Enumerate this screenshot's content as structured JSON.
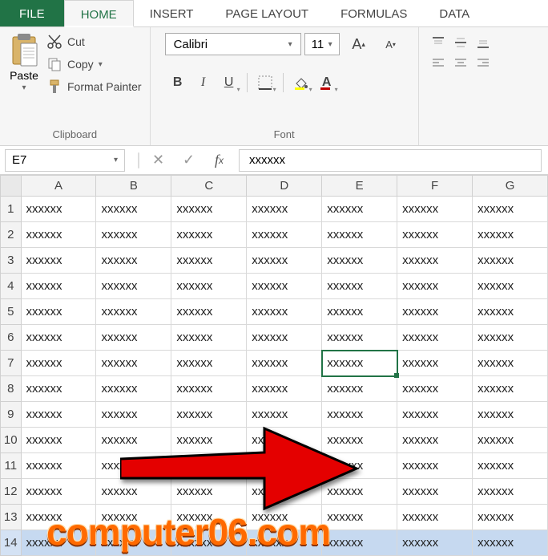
{
  "tabs": {
    "file": "FILE",
    "home": "HOME",
    "insert": "INSERT",
    "page_layout": "PAGE LAYOUT",
    "formulas": "FORMULAS",
    "data": "DATA"
  },
  "ribbon": {
    "clipboard": {
      "label": "Clipboard",
      "paste": "Paste",
      "cut": "Cut",
      "copy": "Copy",
      "format_painter": "Format Painter"
    },
    "font": {
      "label": "Font",
      "name": "Calibri",
      "size": "11",
      "bold": "B",
      "italic": "I",
      "underline": "U",
      "increase": "A",
      "decrease": "A",
      "fill": "A",
      "font_color": "A"
    }
  },
  "namebox": "E7",
  "formula": "xxxxxx",
  "columns": [
    "A",
    "B",
    "C",
    "D",
    "E",
    "F",
    "G"
  ],
  "rows": [
    "1",
    "2",
    "3",
    "4",
    "5",
    "6",
    "7",
    "8",
    "9",
    "10",
    "11",
    "12",
    "13",
    "14"
  ],
  "cell_value": "xxxxxx",
  "selected": {
    "row": 7,
    "col": "E"
  },
  "highlight_row": 14,
  "watermark": "computer06.com"
}
